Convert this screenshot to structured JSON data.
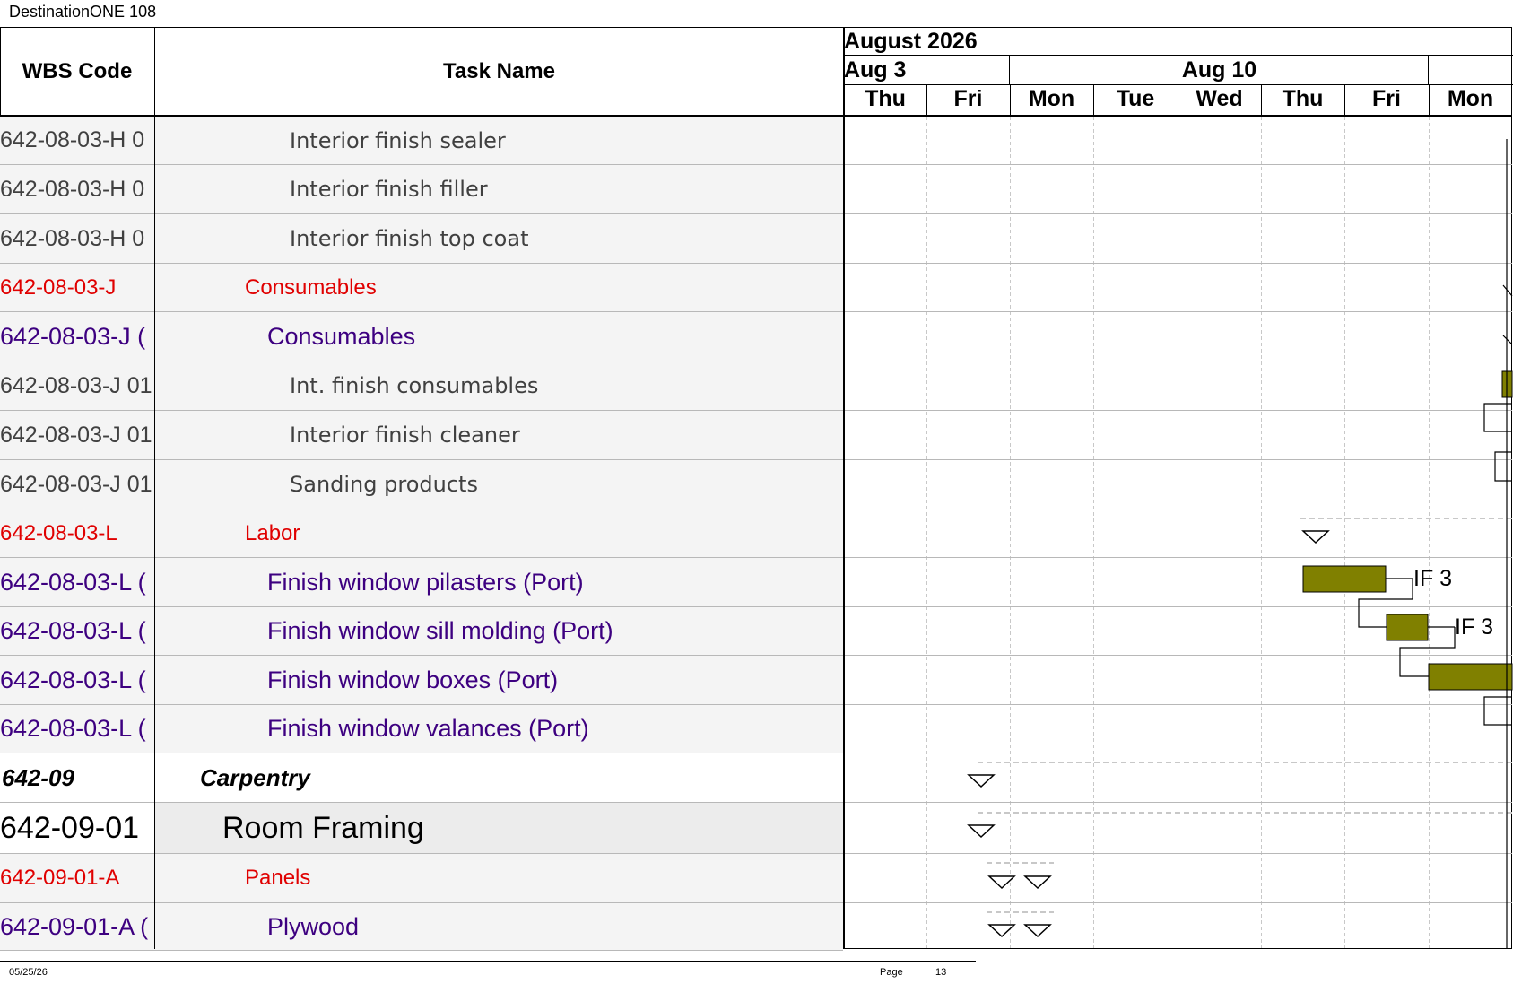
{
  "document": {
    "title": "DestinationONE 108"
  },
  "columns": {
    "wbs_header": "WBS Code",
    "task_header": "Task Name"
  },
  "timeline": {
    "month": "August 2026",
    "weeks": [
      "Aug 3",
      "Aug 10"
    ],
    "days": [
      "Thu",
      "Fri",
      "Mon",
      "Tue",
      "Wed",
      "Thu",
      "Fri",
      "Mon"
    ]
  },
  "rows": [
    {
      "wbs": "642-08-03-H 0",
      "task": "Interior finish sealer",
      "level": "item"
    },
    {
      "wbs": "642-08-03-H 0",
      "task": "Interior finish filler",
      "level": "item"
    },
    {
      "wbs": "642-08-03-H 0",
      "task": "Interior finish top coat",
      "level": "item"
    },
    {
      "wbs": "642-08-03-J",
      "task": "Consumables",
      "level": "cat"
    },
    {
      "wbs": "642-08-03-J (",
      "task": "Consumables",
      "level": "sub"
    },
    {
      "wbs": "642-08-03-J 01",
      "task": "Int. finish consumables",
      "level": "item"
    },
    {
      "wbs": "642-08-03-J 01",
      "task": "Interior finish cleaner",
      "level": "item"
    },
    {
      "wbs": "642-08-03-J 01",
      "task": "Sanding products",
      "level": "item"
    },
    {
      "wbs": "642-08-03-L",
      "task": "Labor",
      "level": "cat"
    },
    {
      "wbs": "642-08-03-L (",
      "task": "Finish window pilasters (Port)",
      "level": "sub"
    },
    {
      "wbs": "642-08-03-L (",
      "task": "Finish window sill molding (Port)",
      "level": "sub"
    },
    {
      "wbs": "642-08-03-L (",
      "task": "Finish window boxes (Port)",
      "level": "sub"
    },
    {
      "wbs": "642-08-03-L (",
      "task": "Finish window valances (Port)",
      "level": "sub"
    },
    {
      "wbs": "642-09",
      "task": "Carpentry",
      "level": "group"
    },
    {
      "wbs": "642-09-01",
      "task": "Room Framing",
      "level": "room"
    },
    {
      "wbs": "642-09-01-A",
      "task": "Panels",
      "level": "cat"
    },
    {
      "wbs": "642-09-01-A (",
      "task": "Plywood",
      "level": "sub"
    }
  ],
  "gantt": {
    "bar_color": "#808000",
    "labels": [
      "IF 3",
      "IF 3"
    ]
  },
  "footer": {
    "date": "05/25/26",
    "page_label": "Page",
    "page_number": "13"
  }
}
